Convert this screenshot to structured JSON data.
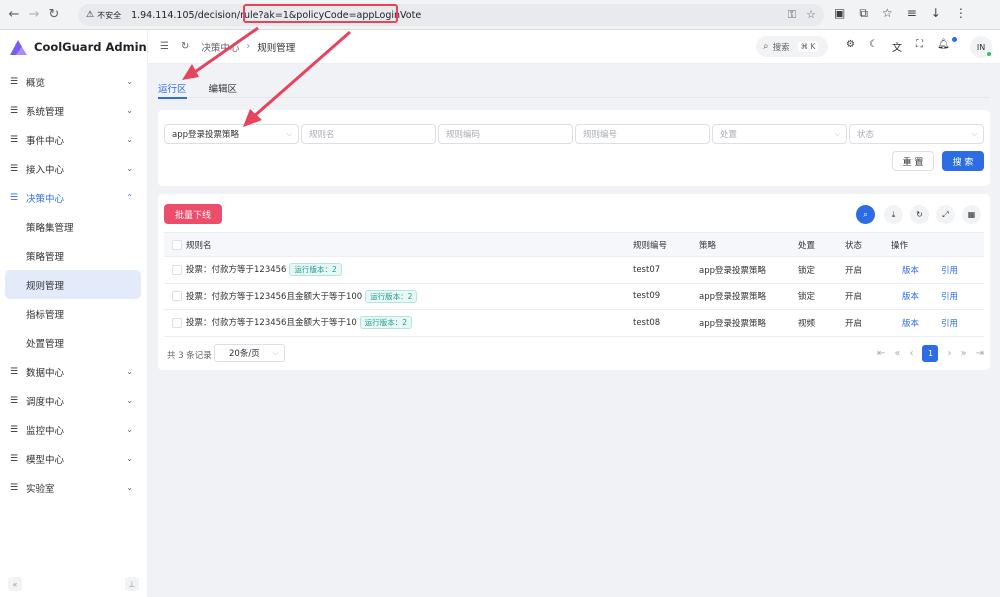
{
  "browser": {
    "security_label": "不安全",
    "url_base": "1.94.114.105/decision/rule",
    "url_query": "?ak=1&policyCode=appLoginVote"
  },
  "sidebar": {
    "app_title": "CoolGuard Admin",
    "items": [
      {
        "label": "概览"
      },
      {
        "label": "系统管理"
      },
      {
        "label": "事件中心"
      },
      {
        "label": "接入中心"
      },
      {
        "label": "决策中心"
      },
      {
        "label": "数据中心"
      },
      {
        "label": "调度中心"
      },
      {
        "label": "监控中心"
      },
      {
        "label": "模型中心"
      },
      {
        "label": "实验室"
      }
    ],
    "subitems": [
      {
        "label": "策略集管理"
      },
      {
        "label": "策略管理"
      },
      {
        "label": "规则管理"
      },
      {
        "label": "指标管理"
      },
      {
        "label": "处置管理"
      }
    ]
  },
  "header": {
    "breadcrumb_parent": "决策中心",
    "breadcrumb_current": "规则管理",
    "search_label": "搜索",
    "search_shortcut": "⌘ K",
    "avatar_initials": "IN"
  },
  "tabs": [
    {
      "label": "运行区"
    },
    {
      "label": "编辑区"
    }
  ],
  "filters": {
    "policy_value": "app登录投票策略",
    "rule_name_placeholder": "规则名",
    "rule_code_placeholder": "规则编码",
    "rule_no_placeholder": "规则编号",
    "disposal_placeholder": "处置",
    "status_placeholder": "状态",
    "reset_label": "重 置",
    "search_label": "搜 索"
  },
  "table": {
    "batch_offline_label": "批量下线",
    "columns": [
      "规则名",
      "规则编号",
      "策略",
      "处置",
      "状态",
      "操作"
    ],
    "rows": [
      {
        "name": "投票：付款方等于123456",
        "tag": "运行版本：2",
        "code": "test07",
        "policy": "app登录投票策略",
        "disposal": "锁定",
        "status": "开启",
        "action1": "版本",
        "action2": "引用"
      },
      {
        "name": "投票：付款方等于123456且金额大于等于100",
        "tag": "运行版本：2",
        "code": "test09",
        "policy": "app登录投票策略",
        "disposal": "锁定",
        "status": "开启",
        "action1": "版本",
        "action2": "引用"
      },
      {
        "name": "投票：付款方等于123456且金额大于等于10",
        "tag": "运行版本：2",
        "code": "test08",
        "policy": "app登录投票策略",
        "disposal": "视频",
        "status": "开启",
        "action1": "版本",
        "action2": "引用"
      }
    ],
    "total_label": "共 3 条记录",
    "page_size": "20条/页",
    "current_page": "1"
  },
  "colors": {
    "primary": "#2c6de4",
    "danger": "#ec4d6a",
    "annotation": "#e8425c"
  }
}
